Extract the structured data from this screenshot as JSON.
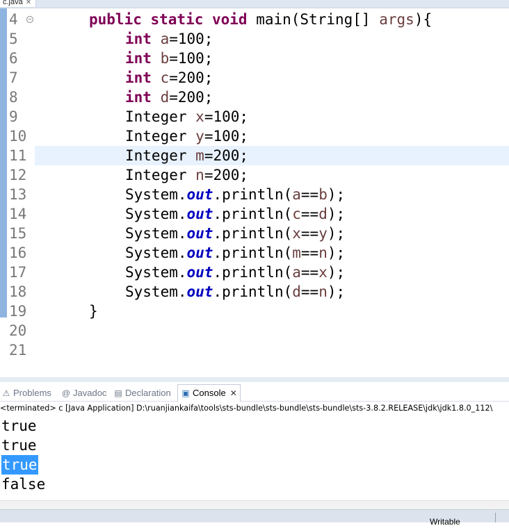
{
  "editor_tab": {
    "title": "c.java",
    "close": "✕"
  },
  "code_lines": [
    {
      "num": "4",
      "segments": [
        [
          "kw",
          "public static void "
        ],
        [
          "",
          "main(String[] "
        ],
        [
          "var",
          "args"
        ],
        [
          "",
          "){"
        ]
      ],
      "indent": 1,
      "fold": true
    },
    {
      "num": "5",
      "segments": [
        [
          "kw",
          "int "
        ],
        [
          "var",
          "a"
        ],
        [
          "",
          "=100;"
        ]
      ],
      "indent": 2
    },
    {
      "num": "6",
      "segments": [
        [
          "kw",
          "int "
        ],
        [
          "var",
          "b"
        ],
        [
          "",
          "=100;"
        ]
      ],
      "indent": 2
    },
    {
      "num": "7",
      "segments": [
        [
          "kw",
          "int "
        ],
        [
          "var",
          "c"
        ],
        [
          "",
          "=200;"
        ]
      ],
      "indent": 2
    },
    {
      "num": "8",
      "segments": [
        [
          "kw",
          "int "
        ],
        [
          "var",
          "d"
        ],
        [
          "",
          "=200;"
        ]
      ],
      "indent": 2
    },
    {
      "num": "9",
      "segments": [
        [
          "",
          "Integer "
        ],
        [
          "var",
          "x"
        ],
        [
          "",
          "=100;"
        ]
      ],
      "indent": 2
    },
    {
      "num": "10",
      "segments": [
        [
          "",
          "Integer "
        ],
        [
          "var",
          "y"
        ],
        [
          "",
          "=100;"
        ]
      ],
      "indent": 2
    },
    {
      "num": "11",
      "segments": [
        [
          "",
          "Integer "
        ],
        [
          "var",
          "m"
        ],
        [
          "",
          "=200;"
        ]
      ],
      "indent": 2,
      "current": true
    },
    {
      "num": "12",
      "segments": [
        [
          "",
          "Integer "
        ],
        [
          "var",
          "n"
        ],
        [
          "",
          "=200;"
        ]
      ],
      "indent": 2
    },
    {
      "num": "13",
      "segments": [
        [
          "",
          "System."
        ],
        [
          "fld",
          "out"
        ],
        [
          "",
          ".println("
        ],
        [
          "var",
          "a"
        ],
        [
          "",
          "=="
        ],
        [
          "var",
          "b"
        ],
        [
          "",
          ");"
        ]
      ],
      "indent": 2
    },
    {
      "num": "14",
      "segments": [
        [
          "",
          "System."
        ],
        [
          "fld",
          "out"
        ],
        [
          "",
          ".println("
        ],
        [
          "var",
          "c"
        ],
        [
          "",
          "=="
        ],
        [
          "var",
          "d"
        ],
        [
          "",
          ");"
        ]
      ],
      "indent": 2
    },
    {
      "num": "15",
      "segments": [
        [
          "",
          "System."
        ],
        [
          "fld",
          "out"
        ],
        [
          "",
          ".println("
        ],
        [
          "var",
          "x"
        ],
        [
          "",
          "=="
        ],
        [
          "var",
          "y"
        ],
        [
          "",
          ");"
        ]
      ],
      "indent": 2
    },
    {
      "num": "16",
      "segments": [
        [
          "",
          "System."
        ],
        [
          "fld",
          "out"
        ],
        [
          "",
          ".println("
        ],
        [
          "var",
          "m"
        ],
        [
          "",
          "=="
        ],
        [
          "var",
          "n"
        ],
        [
          "",
          ");"
        ]
      ],
      "indent": 2
    },
    {
      "num": "17",
      "segments": [
        [
          "",
          "System."
        ],
        [
          "fld",
          "out"
        ],
        [
          "",
          ".println("
        ],
        [
          "var",
          "a"
        ],
        [
          "",
          "=="
        ],
        [
          "var",
          "x"
        ],
        [
          "",
          ");"
        ]
      ],
      "indent": 2
    },
    {
      "num": "18",
      "segments": [
        [
          "",
          "System."
        ],
        [
          "fld",
          "out"
        ],
        [
          "",
          ".println("
        ],
        [
          "var",
          "d"
        ],
        [
          "",
          "=="
        ],
        [
          "var",
          "n"
        ],
        [
          "",
          ");"
        ]
      ],
      "indent": 2
    },
    {
      "num": "19",
      "segments": [
        [
          "",
          "}"
        ]
      ],
      "indent": 1
    },
    {
      "num": "20",
      "segments": [],
      "indent": 0
    },
    {
      "num": "21",
      "segments": [],
      "indent": 0
    }
  ],
  "view_tabs": [
    {
      "label": "Problems",
      "icon": "problems-icon",
      "glyph": "⚠"
    },
    {
      "label": "Javadoc",
      "icon": "javadoc-icon",
      "glyph": "@"
    },
    {
      "label": "Declaration",
      "icon": "declaration-icon",
      "glyph": "▤"
    },
    {
      "label": "Console",
      "icon": "console-icon",
      "glyph": "▣",
      "active": true,
      "close": "✕"
    }
  ],
  "console": {
    "header": "<terminated> c [Java Application] D:\\ruanjiankaifa\\tools\\sts-bundle\\sts-bundle\\sts-bundle\\sts-3.8.2.RELEASE\\jdk\\jdk1.8.0_112\\",
    "output": [
      "true",
      "true",
      "true",
      "false"
    ],
    "selected_index": 2
  },
  "status_bar": {
    "writable": "Writable"
  }
}
